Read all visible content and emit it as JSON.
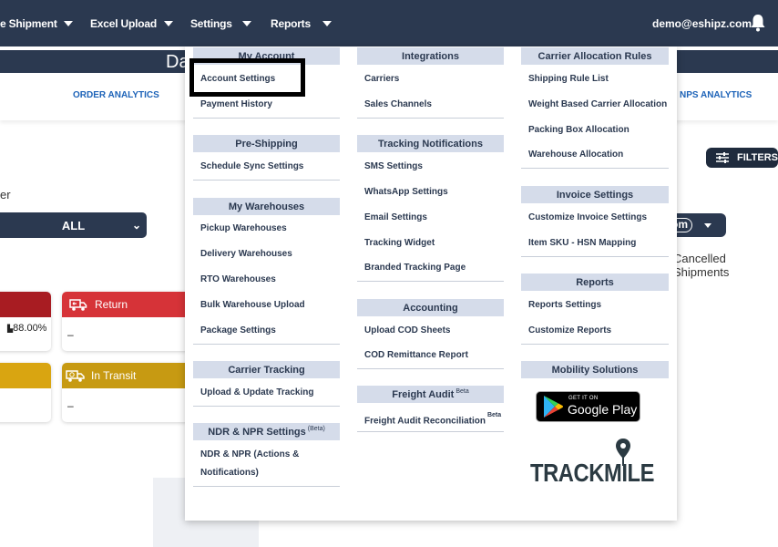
{
  "nav": {
    "items": [
      {
        "label": "e Shipment"
      },
      {
        "label": "Excel Upload"
      },
      {
        "label": "Settings"
      },
      {
        "label": "Reports"
      }
    ],
    "user_email": "demo@eshipz.com"
  },
  "dashboard": {
    "title": "Da",
    "analytics_tabs": [
      "ORDER ANALYTICS",
      "NPS ANALYTICS"
    ],
    "filters_label": "FILTERS",
    "partial_label": "er",
    "select_value": "ALL",
    "right_pill_text": "om",
    "cancelled_label": "Cancelled Shipments",
    "cards": [
      {
        "label": "Return",
        "value": "–",
        "color": "#d63338"
      },
      {
        "label": "In Transit",
        "value": "–",
        "color": "#d9a511"
      }
    ],
    "partial_percent": "88.00%"
  },
  "menu": {
    "col1": {
      "sections": [
        {
          "title": "My Account",
          "items": [
            "Account Settings",
            "Payment History"
          ]
        },
        {
          "title": "Pre-Shipping",
          "items": [
            "Schedule Sync Settings"
          ]
        },
        {
          "title": "My Warehouses",
          "items": [
            "Pickup Warehouses",
            "Delivery Warehouses",
            "RTO Warehouses",
            "Bulk Warehouse Upload",
            "Package Settings"
          ]
        },
        {
          "title": "Carrier Tracking",
          "items": [
            "Upload & Update Tracking"
          ]
        },
        {
          "title": "NDR & NPR Settings",
          "title_sup": "(Beta)",
          "items": [
            "NDR & NPR (Actions &",
            "Notifications)"
          ]
        }
      ]
    },
    "col2": {
      "sections": [
        {
          "title": "Integrations",
          "items": [
            "Carriers",
            "Sales Channels"
          ]
        },
        {
          "title": "Tracking Notifications",
          "items": [
            "SMS Settings",
            "WhatsApp Settings",
            "Email Settings",
            "Tracking Widget",
            "Branded Tracking Page"
          ]
        },
        {
          "title": "Accounting",
          "items": [
            "Upload COD Sheets",
            "COD Remittance Report"
          ]
        },
        {
          "title": "Freight Audit",
          "title_sup": "Beta",
          "items": [
            "Freight Audit Reconciliation"
          ],
          "item_sup": "Beta"
        }
      ]
    },
    "col3": {
      "sections": [
        {
          "title": "Carrier Allocation Rules",
          "items": [
            "Shipping Rule List",
            "Weight Based Carrier Allocation",
            "Packing Box Allocation",
            "Warehouse Allocation"
          ]
        },
        {
          "title": "Invoice Settings",
          "items": [
            "Customize Invoice Settings",
            "Item SKU - HSN Mapping"
          ]
        },
        {
          "title": "Reports",
          "items": [
            "Reports Settings",
            "Customize Reports"
          ]
        },
        {
          "title": "Mobility Solutions",
          "items": []
        }
      ]
    },
    "google_play": {
      "small": "GET IT ON",
      "big": "Google Play"
    },
    "trackmile_logo": "TRACKMILE"
  },
  "colors": {
    "navy": "#2b3950",
    "section_bg": "#d5dcea",
    "link_blue": "#1d63b8"
  }
}
